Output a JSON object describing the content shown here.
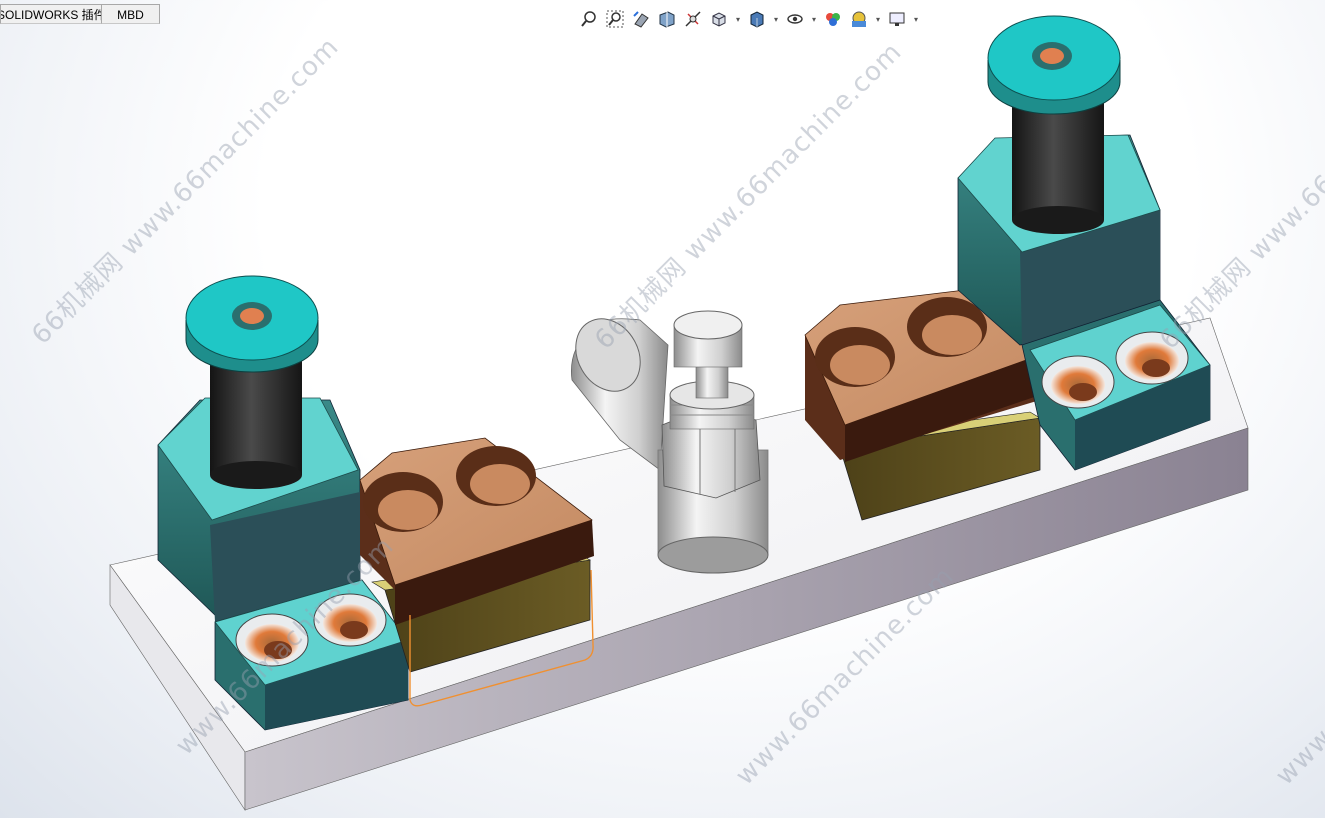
{
  "tabs": [
    {
      "label": "SOLIDWORKS 插件"
    },
    {
      "label": "MBD"
    }
  ],
  "heads_up_toolbar": [
    {
      "icon": "zoom-to-fit-icon"
    },
    {
      "icon": "zoom-to-area-icon"
    },
    {
      "icon": "previous-view-icon"
    },
    {
      "icon": "section-view-icon"
    },
    {
      "icon": "dynamic-annotation-icon"
    },
    {
      "icon": "view-orientation-icon",
      "dropdown": true
    },
    {
      "icon": "display-style-icon",
      "dropdown": true
    },
    {
      "icon": "hide-show-items-icon",
      "dropdown": true
    },
    {
      "icon": "edit-appearance-icon"
    },
    {
      "icon": "apply-scene-icon",
      "dropdown": true
    },
    {
      "icon": "view-settings-icon",
      "dropdown": true
    }
  ],
  "watermark": {
    "text_url": "www.66machine.com",
    "text_cn": "66机械网",
    "text_full": "66机械网 www.66machine.com"
  },
  "colors": {
    "base_plate_top": "#f4f4f6",
    "base_plate_side": "#8c8494",
    "block_teal": "#2a6f6e",
    "block_teal_light": "#5fd2cf",
    "clamp_copper": "#c89068",
    "pad_olive": "#5c4f1e",
    "cylinder_silver": "#c9c9c9",
    "selection_orange": "#f09030"
  }
}
